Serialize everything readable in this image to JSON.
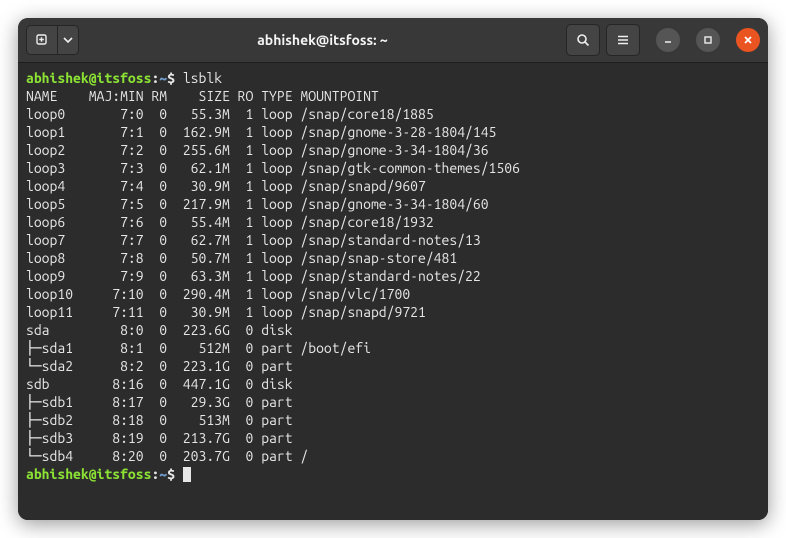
{
  "title": "abhishek@itsfoss: ~",
  "prompt": "abhishek@itsfoss",
  "prompt_path": "~",
  "prompt_sep1": ":",
  "prompt_sep2": "$",
  "command": "lsblk",
  "header": [
    "NAME",
    "MAJ:MIN",
    "RM",
    "SIZE",
    "RO",
    "TYPE",
    "MOUNTPOINT"
  ],
  "rows": [
    {
      "tree": "",
      "name": "loop0",
      "majmin": "7:0",
      "rm": "0",
      "size": "55.3M",
      "ro": "1",
      "type": "loop",
      "mount": "/snap/core18/1885"
    },
    {
      "tree": "",
      "name": "loop1",
      "majmin": "7:1",
      "rm": "0",
      "size": "162.9M",
      "ro": "1",
      "type": "loop",
      "mount": "/snap/gnome-3-28-1804/145"
    },
    {
      "tree": "",
      "name": "loop2",
      "majmin": "7:2",
      "rm": "0",
      "size": "255.6M",
      "ro": "1",
      "type": "loop",
      "mount": "/snap/gnome-3-34-1804/36"
    },
    {
      "tree": "",
      "name": "loop3",
      "majmin": "7:3",
      "rm": "0",
      "size": "62.1M",
      "ro": "1",
      "type": "loop",
      "mount": "/snap/gtk-common-themes/1506"
    },
    {
      "tree": "",
      "name": "loop4",
      "majmin": "7:4",
      "rm": "0",
      "size": "30.9M",
      "ro": "1",
      "type": "loop",
      "mount": "/snap/snapd/9607"
    },
    {
      "tree": "",
      "name": "loop5",
      "majmin": "7:5",
      "rm": "0",
      "size": "217.9M",
      "ro": "1",
      "type": "loop",
      "mount": "/snap/gnome-3-34-1804/60"
    },
    {
      "tree": "",
      "name": "loop6",
      "majmin": "7:6",
      "rm": "0",
      "size": "55.4M",
      "ro": "1",
      "type": "loop",
      "mount": "/snap/core18/1932"
    },
    {
      "tree": "",
      "name": "loop7",
      "majmin": "7:7",
      "rm": "0",
      "size": "62.7M",
      "ro": "1",
      "type": "loop",
      "mount": "/snap/standard-notes/13"
    },
    {
      "tree": "",
      "name": "loop8",
      "majmin": "7:8",
      "rm": "0",
      "size": "50.7M",
      "ro": "1",
      "type": "loop",
      "mount": "/snap/snap-store/481"
    },
    {
      "tree": "",
      "name": "loop9",
      "majmin": "7:9",
      "rm": "0",
      "size": "63.3M",
      "ro": "1",
      "type": "loop",
      "mount": "/snap/standard-notes/22"
    },
    {
      "tree": "",
      "name": "loop10",
      "majmin": "7:10",
      "rm": "0",
      "size": "290.4M",
      "ro": "1",
      "type": "loop",
      "mount": "/snap/vlc/1700"
    },
    {
      "tree": "",
      "name": "loop11",
      "majmin": "7:11",
      "rm": "0",
      "size": "30.9M",
      "ro": "1",
      "type": "loop",
      "mount": "/snap/snapd/9721"
    },
    {
      "tree": "",
      "name": "sda",
      "majmin": "8:0",
      "rm": "0",
      "size": "223.6G",
      "ro": "0",
      "type": "disk",
      "mount": ""
    },
    {
      "tree": "├─",
      "name": "sda1",
      "majmin": "8:1",
      "rm": "0",
      "size": "512M",
      "ro": "0",
      "type": "part",
      "mount": "/boot/efi"
    },
    {
      "tree": "└─",
      "name": "sda2",
      "majmin": "8:2",
      "rm": "0",
      "size": "223.1G",
      "ro": "0",
      "type": "part",
      "mount": ""
    },
    {
      "tree": "",
      "name": "sdb",
      "majmin": "8:16",
      "rm": "0",
      "size": "447.1G",
      "ro": "0",
      "type": "disk",
      "mount": ""
    },
    {
      "tree": "├─",
      "name": "sdb1",
      "majmin": "8:17",
      "rm": "0",
      "size": "29.3G",
      "ro": "0",
      "type": "part",
      "mount": ""
    },
    {
      "tree": "├─",
      "name": "sdb2",
      "majmin": "8:18",
      "rm": "0",
      "size": "513M",
      "ro": "0",
      "type": "part",
      "mount": ""
    },
    {
      "tree": "├─",
      "name": "sdb3",
      "majmin": "8:19",
      "rm": "0",
      "size": "213.7G",
      "ro": "0",
      "type": "part",
      "mount": ""
    },
    {
      "tree": "└─",
      "name": "sdb4",
      "majmin": "8:20",
      "rm": "0",
      "size": "203.7G",
      "ro": "0",
      "type": "part",
      "mount": "/"
    }
  ]
}
